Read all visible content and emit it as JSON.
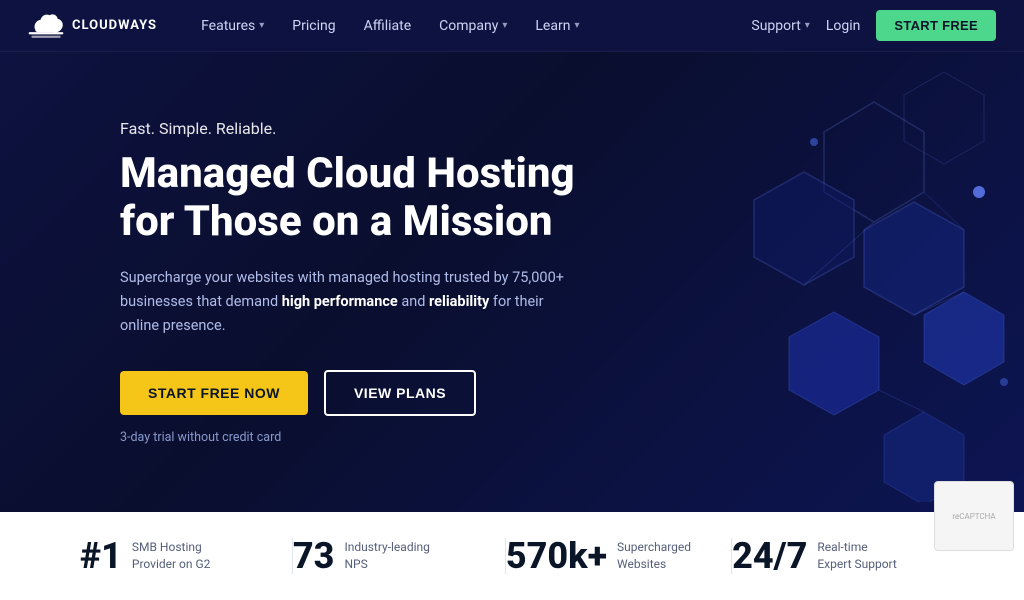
{
  "navbar": {
    "logo_text": "CLOUDWAYS",
    "nav_items": [
      {
        "label": "Features",
        "has_dropdown": true
      },
      {
        "label": "Pricing",
        "has_dropdown": false
      },
      {
        "label": "Affiliate",
        "has_dropdown": false
      },
      {
        "label": "Company",
        "has_dropdown": true
      },
      {
        "label": "Learn",
        "has_dropdown": true
      }
    ],
    "support_label": "Support",
    "login_label": "Login",
    "start_free_label": "START FREE"
  },
  "hero": {
    "tagline": "Fast. Simple. Reliable.",
    "title_line1": "Managed Cloud Hosting",
    "title_line2": "for Those on a Mission",
    "description_prefix": "Supercharge your websites with managed hosting trusted by 75,000+ businesses that demand ",
    "description_bold1": "high performance",
    "description_mid": " and ",
    "description_bold2": "reliability",
    "description_suffix": " for their online presence.",
    "btn_primary_label": "START FREE NOW",
    "btn_secondary_label": "VIEW PLANS",
    "trial_note": "3-day trial without credit card"
  },
  "stats": [
    {
      "number": "#1",
      "label": "SMB Hosting Provider on G2"
    },
    {
      "number": "73",
      "label": "Industry-leading NPS"
    },
    {
      "number": "570k+",
      "label": "Supercharged Websites"
    },
    {
      "number": "24/7",
      "label": "Real-time Expert Support"
    }
  ],
  "colors": {
    "primary_bg": "#0d1240",
    "accent_yellow": "#f5c518",
    "accent_green": "#4dd78c",
    "text_light": "#b0bce8"
  }
}
